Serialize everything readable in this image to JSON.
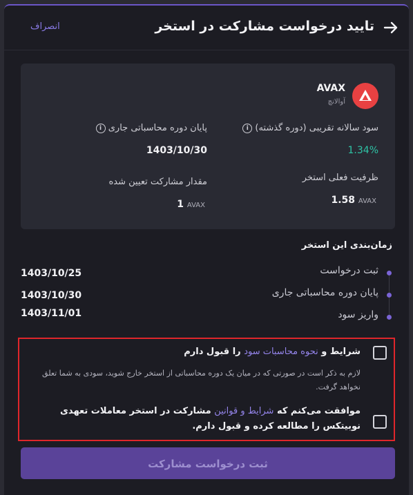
{
  "header": {
    "title": "تایید درخواست مشارکت در استخر",
    "cancel_label": "انصراف",
    "back_icon": "arrow-right-icon"
  },
  "card": {
    "coin": {
      "symbol": "AVAX",
      "name": "آوالانچ",
      "logo_color": "#e84142"
    },
    "apr_label": "سود سالانه تقریبی (دوره گذشته)",
    "apr_value": "1.34%",
    "period_end_label": "پایان دوره محاسباتی جاری",
    "period_end_value": "1403/10/30",
    "capacity_label": "ظرفیت فعلی استخر",
    "capacity_value": "1.58",
    "capacity_unit": "AVAX",
    "amount_label": "مقدار مشارکت تعیین شده",
    "amount_value": "1",
    "amount_unit": "AVAX"
  },
  "schedule": {
    "title": "زمان‌بندی این استخر",
    "items": [
      {
        "label": "ثبت درخواست",
        "date": "1403/10/25"
      },
      {
        "label": "پایان دوره محاسباتی جاری",
        "date": "1403/10/30"
      },
      {
        "label": "واریز سود",
        "date": "1403/11/01"
      }
    ]
  },
  "agreements": {
    "first": {
      "prefix": "شرایط و",
      "link": "نحوه محاسبات سود",
      "suffix": "را قبول دارم",
      "note": "لازم به ذکر است در صورتی که در میان یک دوره محاسباتی از استخر خارج شوید، سودی به شما تعلق نخواهد گرفت."
    },
    "second": {
      "prefix": "موافقت می‌کنم که",
      "link": "شرایط و قوانین",
      "suffix": "مشارکت در استخر معاملات تعهدی نوبیتکس را مطالعه کرده و قبول دارم."
    }
  },
  "submit_label": "ثبت درخواست مشارکت",
  "colors": {
    "accent": "#7a64d6",
    "positive": "#2ec4a6",
    "highlight_border": "#e0262b"
  }
}
